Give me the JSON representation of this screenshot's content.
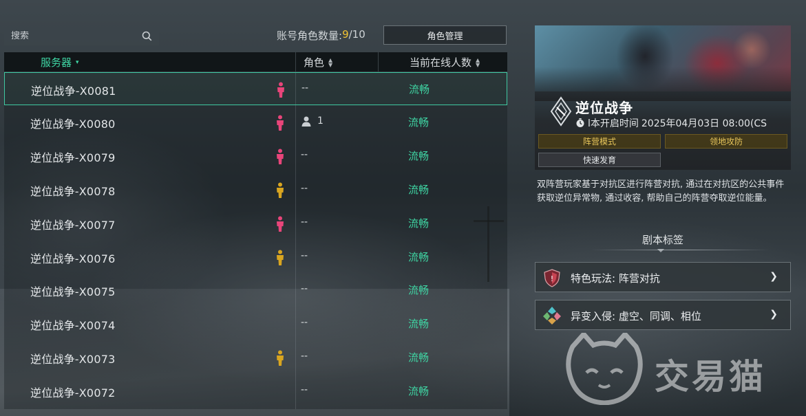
{
  "search": {
    "placeholder": "搜索"
  },
  "account": {
    "label": "账号角色数量: ",
    "current": "9",
    "separator": "/",
    "max": "10"
  },
  "manage_button": "角色管理",
  "table": {
    "headers": {
      "server": "服务器",
      "role": "角色",
      "online": "当前在线人数"
    },
    "rows": [
      {
        "name": "逆位战争-X0081",
        "faction": "red",
        "role": "--",
        "role_count": "",
        "status": "流畅"
      },
      {
        "name": "逆位战争-X0080",
        "faction": "red",
        "role": "",
        "role_count": "1",
        "status": "流畅"
      },
      {
        "name": "逆位战争-X0079",
        "faction": "red",
        "role": "--",
        "role_count": "",
        "status": "流畅"
      },
      {
        "name": "逆位战争-X0078",
        "faction": "gold",
        "role": "--",
        "role_count": "",
        "status": "流畅"
      },
      {
        "name": "逆位战争-X0077",
        "faction": "red",
        "role": "--",
        "role_count": "",
        "status": "流畅"
      },
      {
        "name": "逆位战争-X0076",
        "faction": "gold",
        "role": "--",
        "role_count": "",
        "status": "流畅"
      },
      {
        "name": "逆位战争-X0075",
        "faction": "none",
        "role": "--",
        "role_count": "",
        "status": "流畅"
      },
      {
        "name": "逆位战争-X0074",
        "faction": "none",
        "role": "--",
        "role_count": "",
        "status": "流畅"
      },
      {
        "name": "逆位战争-X0073",
        "faction": "gold",
        "role": "--",
        "role_count": "",
        "status": "流畅"
      },
      {
        "name": "逆位战争-X0072",
        "faction": "none",
        "role": "--",
        "role_count": "",
        "status": "流畅"
      }
    ]
  },
  "detail": {
    "title": "逆位战争",
    "open_time_label": "l本开启时间",
    "open_time_value": "2025年04月03日 08:00(CS",
    "tags": [
      "阵营模式",
      "领地攻防",
      "快速发育"
    ],
    "description": "双阵营玩家基于对抗区进行阵营对抗, 通过在对抗区的公共事件获取逆位异常物, 通过收容, 帮助自己的阵营夺取逆位能量。",
    "section_title": "剧本标签",
    "features": [
      {
        "label": "特色玩法: 阵营对抗",
        "icon": "shield-icon"
      },
      {
        "label": "异变入侵: 虚空、同调、相位",
        "icon": "puzzle-icon"
      }
    ]
  },
  "watermark": "交易猫",
  "colors": {
    "accent": "#3fd6a4",
    "gold": "#f1c232",
    "faction_red": "#e8457a",
    "faction_gold": "#d9a520"
  }
}
